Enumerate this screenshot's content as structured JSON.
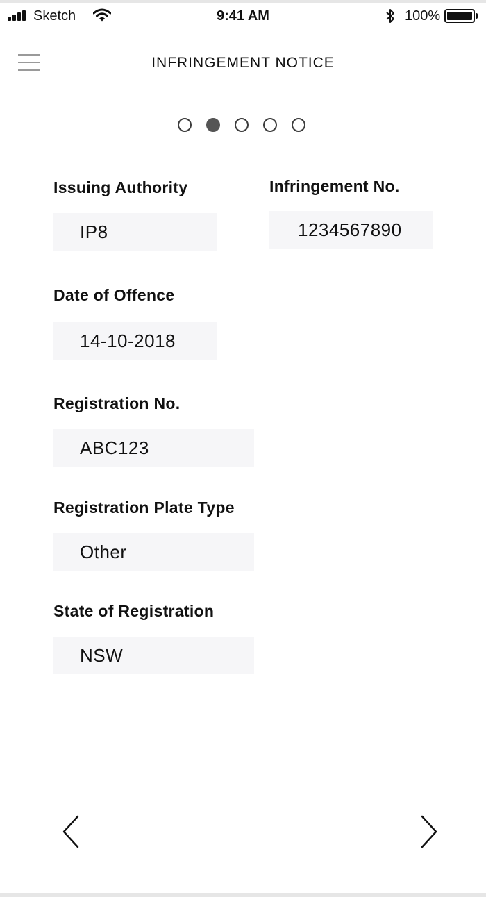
{
  "status_bar": {
    "carrier": "Sketch",
    "time": "9:41 AM",
    "battery_percent": "100%",
    "signal_icon": "signal-bars-icon",
    "wifi_icon": "wifi-icon",
    "bluetooth_icon": "bluetooth-icon",
    "battery_icon": "battery-full-icon"
  },
  "header": {
    "title": "INFRINGEMENT NOTICE",
    "menu_icon": "hamburger-menu-icon"
  },
  "pagination": {
    "total": 5,
    "current": 2
  },
  "form": {
    "issuing_authority": {
      "label": "Issuing Authority",
      "value": "IP8"
    },
    "infringement_no": {
      "label": "Infringement No.",
      "value": "1234567890"
    },
    "date_of_offence": {
      "label": "Date of Offence",
      "value": "14-10-2018"
    },
    "registration_no": {
      "label": "Registration No.",
      "value": "ABC123"
    },
    "plate_type": {
      "label": "Registration Plate Type",
      "value": "Other"
    },
    "state": {
      "label": "State of Registration",
      "value": "NSW"
    }
  },
  "navigation": {
    "prev_icon": "chevron-left-icon",
    "next_icon": "chevron-right-icon"
  },
  "colors": {
    "field_background": "#f6f6f8",
    "active_dot": "#555555",
    "menu_lines": "#9a9a9a"
  }
}
